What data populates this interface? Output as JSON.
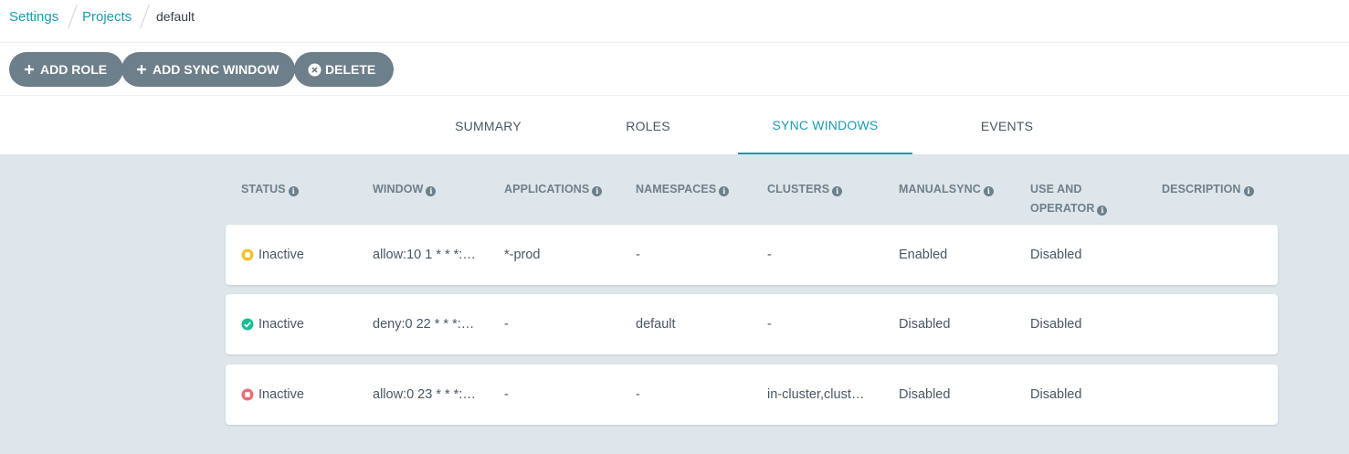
{
  "breadcrumb": {
    "items": [
      {
        "label": "Settings"
      },
      {
        "label": "Projects"
      },
      {
        "label": "default"
      }
    ]
  },
  "toolbar": {
    "add_role": "ADD ROLE",
    "add_sync_window": "ADD SYNC WINDOW",
    "delete": "DELETE"
  },
  "tabs": {
    "summary": "SUMMARY",
    "roles": "ROLES",
    "sync_windows": "SYNC WINDOWS",
    "events": "EVENTS",
    "active": "SYNC WINDOWS"
  },
  "table": {
    "headers": {
      "status": "STATUS",
      "window": "WINDOW",
      "applications": "APPLICATIONS",
      "namespaces": "NAMESPACES",
      "clusters": "CLUSTERS",
      "manualsync": "MANUALSYNC",
      "use_and_operator_1": "USE AND",
      "use_and_operator_2": "OPERATOR",
      "description": "DESCRIPTION"
    },
    "rows": [
      {
        "status_icon": "pause-square-icon",
        "status_color": "#f4c030",
        "status": "Inactive",
        "window": "allow:10 1 * * *:…",
        "applications": "*-prod",
        "namespaces": "-",
        "clusters": "-",
        "manualsync": "Enabled",
        "use_and_operator": "Disabled",
        "description": ""
      },
      {
        "status_icon": "check-circle-icon",
        "status_color": "#18be94",
        "status": "Inactive",
        "window": "deny:0 22 * * *:…",
        "applications": "-",
        "namespaces": "default",
        "clusters": "-",
        "manualsync": "Disabled",
        "use_and_operator": "Disabled",
        "description": ""
      },
      {
        "status_icon": "stop-square-icon",
        "status_color": "#e96d76",
        "status": "Inactive",
        "window": "allow:0 23 * * *:…",
        "applications": "-",
        "namespaces": "-",
        "clusters": "in-cluster,clust…",
        "manualsync": "Disabled",
        "use_and_operator": "Disabled",
        "description": ""
      }
    ]
  }
}
